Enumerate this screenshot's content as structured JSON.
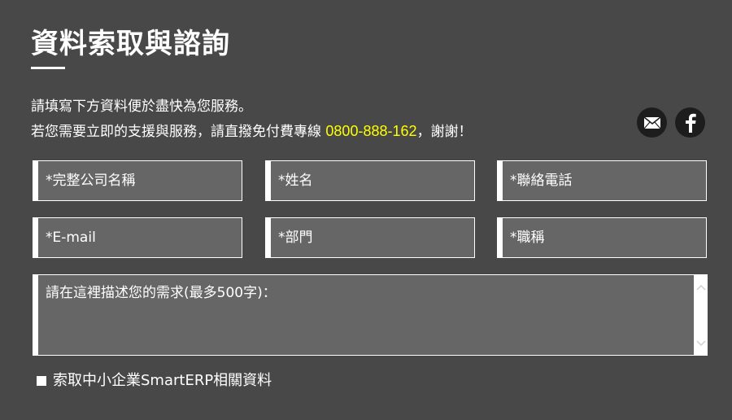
{
  "header": {
    "title": "資料索取與諮詢"
  },
  "intro": {
    "line1": "請填寫下方資料便於盡快為您服務。",
    "line2_prefix": "若您需要立即的支援與服務，請直撥免付費專線 ",
    "hotline": "0800-888-162",
    "line2_suffix": "，謝謝！"
  },
  "social": {
    "email_icon": "mail-icon",
    "facebook_icon": "facebook-icon"
  },
  "form": {
    "fields": [
      {
        "placeholder": "*完整公司名稱",
        "value": ""
      },
      {
        "placeholder": "*姓名",
        "value": ""
      },
      {
        "placeholder": "*聯絡電話",
        "value": ""
      },
      {
        "placeholder": "*E-mail",
        "value": ""
      },
      {
        "placeholder": "*部門",
        "value": ""
      },
      {
        "placeholder": "*職稱",
        "value": ""
      }
    ],
    "message": {
      "placeholder": "請在這裡描述您的需求(最多500字)：",
      "value": ""
    },
    "checkbox_label": "索取中小企業SmartERP相關資料"
  },
  "colors": {
    "background": "#484848",
    "input_background": "#666666",
    "border": "#ffffff",
    "text": "#ffffff",
    "hotline": "#ffff00",
    "icon_background": "#1d1d1d"
  }
}
